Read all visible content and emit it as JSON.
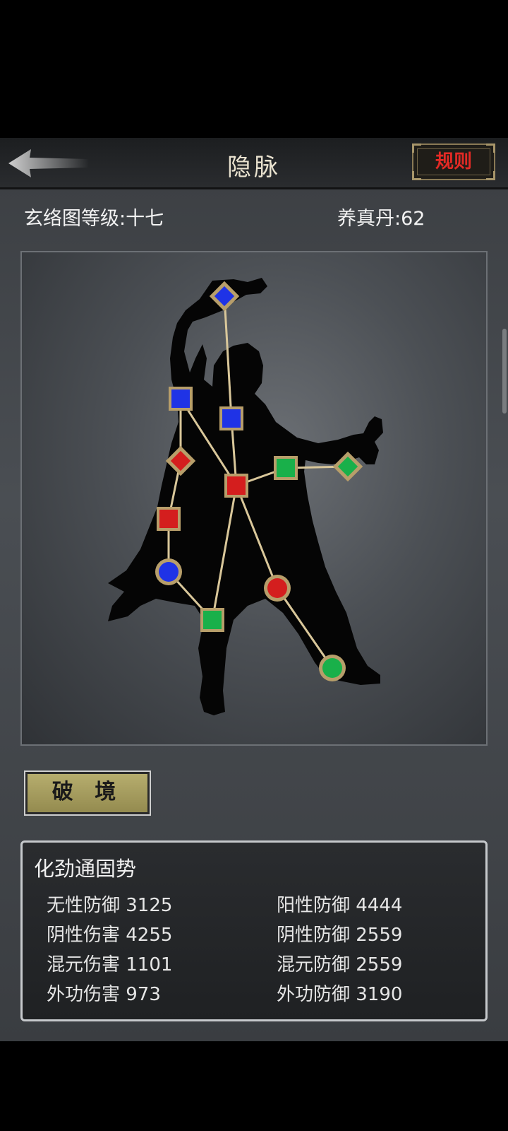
{
  "header": {
    "title": "隐脉",
    "rules_label": "规则"
  },
  "info": {
    "level_text": "玄络图等级:十七",
    "pill_text": "养真丹:62"
  },
  "actions": {
    "break_label": "破 境"
  },
  "stats": {
    "heading": "化劲通固势",
    "left": [
      {
        "label": "无性防御 3125"
      },
      {
        "label": "阴性伤害 4255"
      },
      {
        "label": "混元伤害 1101"
      },
      {
        "label": "外功伤害 973"
      }
    ],
    "right": [
      {
        "label": "阳性防御 4444"
      },
      {
        "label": "阴性防御 2559"
      },
      {
        "label": "混元防御 2559"
      },
      {
        "label": "外功防御 3190"
      }
    ]
  },
  "colors": {
    "blue": "#1f33e6",
    "red": "#d41e1e",
    "green": "#19b04a",
    "gold": "#b79e6a",
    "line": "#d9c79a"
  },
  "nodes": [
    {
      "id": "n1",
      "shape": "diamond",
      "color": "blue"
    },
    {
      "id": "n2",
      "shape": "square",
      "color": "blue"
    },
    {
      "id": "n3",
      "shape": "square",
      "color": "blue"
    },
    {
      "id": "n4",
      "shape": "diamond",
      "color": "red"
    },
    {
      "id": "n5",
      "shape": "square",
      "color": "red"
    },
    {
      "id": "n6",
      "shape": "square",
      "color": "green"
    },
    {
      "id": "n7",
      "shape": "diamond",
      "color": "green"
    },
    {
      "id": "n8",
      "shape": "square",
      "color": "red"
    },
    {
      "id": "n9",
      "shape": "circle",
      "color": "blue"
    },
    {
      "id": "n10",
      "shape": "circle",
      "color": "red"
    },
    {
      "id": "n11",
      "shape": "square",
      "color": "green"
    },
    {
      "id": "n12",
      "shape": "circle",
      "color": "green"
    }
  ]
}
